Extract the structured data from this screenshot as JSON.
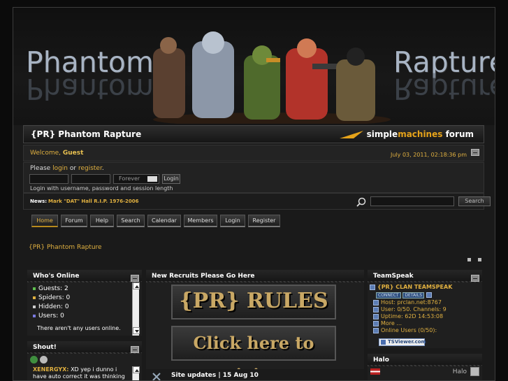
{
  "header": {
    "logo_left": "Phantom",
    "logo_right": "Rapture",
    "site_title": "{PR} Phantom Rapture",
    "smf_logo_prefix": "simple",
    "smf_logo_bold": "machines",
    "smf_logo_suffix": " forum"
  },
  "userbar": {
    "welcome_prefix": "Welcome, ",
    "guest": "Guest",
    "datetime": "July 03, 2011, 02:18:36 pm"
  },
  "login": {
    "please": "Please ",
    "login_link": "login",
    "or": " or ",
    "register_link": "register",
    "period": ".",
    "duration": "Forever",
    "login_button": "Login",
    "note": "Login with username, password and session length"
  },
  "news": {
    "label": "News:",
    "text": "Mark \"DAT\" Hall R.I.P. 1976-2006",
    "search_button": "Search"
  },
  "menu": [
    "Home",
    "Forum",
    "Help",
    "Search",
    "Calendar",
    "Members",
    "Login",
    "Register"
  ],
  "forum_link": "{PR} Phantom Rapture",
  "whos_online": {
    "title": "Who's Online",
    "lines": [
      "Guests: 2",
      "Spiders: 0",
      "Hidden: 0",
      "Users: 0"
    ],
    "empty": "There aren't any users online."
  },
  "shout": {
    "title": "Shout!",
    "user": "XENERGYX:",
    "message": "XD yep i dunno i have auto correct it was thinking"
  },
  "center": {
    "title": "New Recruits Please Go Here",
    "rules": "{PR} RULES",
    "join": "Click here to join",
    "updates": "Site updates | 15 Aug 10"
  },
  "teamspeak": {
    "title": "TeamSpeak",
    "server": "{PR} CLAN TEAMSPEAK",
    "connect": "CONNECT",
    "details": "DETAILS",
    "host": "Host: prclan.net:8767",
    "users": "User: 0/50. Channels: 9",
    "uptime": "Uptime: 62D 14:53:08",
    "more": "More ...",
    "online": "Online Users (0/50):",
    "viewer": "TSViewer.com"
  },
  "halo": {
    "title": "Halo",
    "label": "Halo"
  },
  "colors": {
    "accent": "#e0b040",
    "background": "#1a1a1a"
  }
}
